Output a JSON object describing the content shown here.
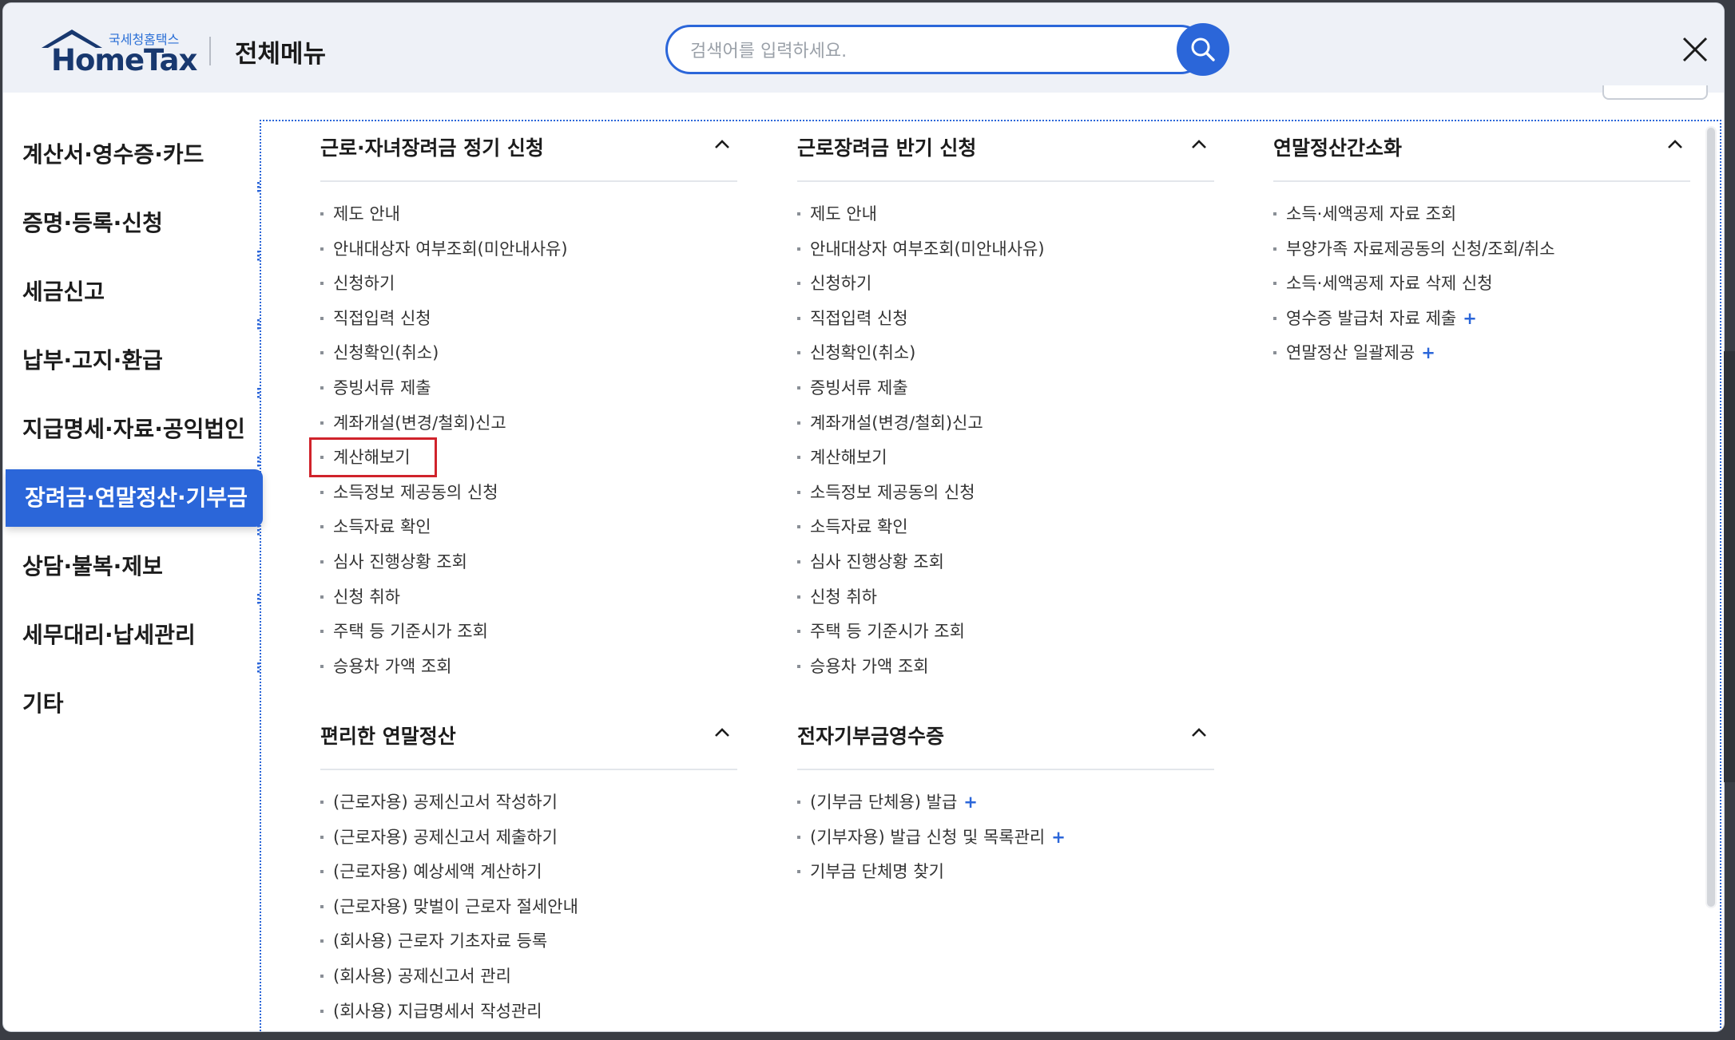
{
  "header": {
    "logo_sub": "국세청홈택스",
    "logo_main": "HomeTax",
    "title": "전체메뉴",
    "search_placeholder": "검색어를 입력하세요."
  },
  "sidebar": {
    "items": [
      {
        "label": "계산서·영수증·카드",
        "active": false
      },
      {
        "label": "증명·등록·신청",
        "active": false
      },
      {
        "label": "세금신고",
        "active": false
      },
      {
        "label": "납부·고지·환급",
        "active": false
      },
      {
        "label": "지급명세·자료·공익법인",
        "active": false
      },
      {
        "label": "장려금·연말정산·기부금",
        "active": true
      },
      {
        "label": "상담·불복·제보",
        "active": false
      },
      {
        "label": "세무대리·납세관리",
        "active": false
      },
      {
        "label": "기타",
        "active": false
      }
    ]
  },
  "sections": [
    {
      "title": "근로·자녀장려금 정기 신청",
      "items": [
        {
          "label": "제도 안내",
          "plus": false
        },
        {
          "label": "안내대상자 여부조회(미안내사유)",
          "plus": false
        },
        {
          "label": "신청하기",
          "plus": false
        },
        {
          "label": "직접입력 신청",
          "plus": false
        },
        {
          "label": "신청확인(취소)",
          "plus": false
        },
        {
          "label": "증빙서류 제출",
          "plus": false
        },
        {
          "label": "계좌개설(변경/철회)신고",
          "plus": false
        },
        {
          "label": "계산해보기",
          "plus": false
        },
        {
          "label": "소득정보 제공동의 신청",
          "plus": false
        },
        {
          "label": "소득자료 확인",
          "plus": false
        },
        {
          "label": "심사 진행상황 조회",
          "plus": false
        },
        {
          "label": "신청 취하",
          "plus": false
        },
        {
          "label": "주택 등 기준시가 조회",
          "plus": false
        },
        {
          "label": "승용차 가액 조회",
          "plus": false
        }
      ]
    },
    {
      "title": "근로장려금 반기 신청",
      "items": [
        {
          "label": "제도 안내",
          "plus": false
        },
        {
          "label": "안내대상자 여부조회(미안내사유)",
          "plus": false
        },
        {
          "label": "신청하기",
          "plus": false
        },
        {
          "label": "직접입력 신청",
          "plus": false
        },
        {
          "label": "신청확인(취소)",
          "plus": false
        },
        {
          "label": "증빙서류 제출",
          "plus": false
        },
        {
          "label": "계좌개설(변경/철회)신고",
          "plus": false
        },
        {
          "label": "계산해보기",
          "plus": false
        },
        {
          "label": "소득정보 제공동의 신청",
          "plus": false
        },
        {
          "label": "소득자료 확인",
          "plus": false
        },
        {
          "label": "심사 진행상황 조회",
          "plus": false
        },
        {
          "label": "신청 취하",
          "plus": false
        },
        {
          "label": "주택 등 기준시가 조회",
          "plus": false
        },
        {
          "label": "승용차 가액 조회",
          "plus": false
        }
      ]
    },
    {
      "title": "연말정산간소화",
      "items": [
        {
          "label": "소득·세액공제 자료 조회",
          "plus": false
        },
        {
          "label": "부양가족 자료제공동의 신청/조회/취소",
          "plus": false
        },
        {
          "label": "소득·세액공제 자료 삭제 신청",
          "plus": false
        },
        {
          "label": "영수증 발급처 자료 제출",
          "plus": true
        },
        {
          "label": "연말정산 일괄제공",
          "plus": true
        }
      ]
    },
    {
      "title": "편리한 연말정산",
      "items": [
        {
          "label": "(근로자용) 공제신고서 작성하기",
          "plus": false
        },
        {
          "label": "(근로자용) 공제신고서 제출하기",
          "plus": false
        },
        {
          "label": "(근로자용) 예상세액 계산하기",
          "plus": false
        },
        {
          "label": "(근로자용) 맞벌이 근로자 절세안내",
          "plus": false
        },
        {
          "label": "(회사용) 근로자 기초자료 등록",
          "plus": false
        },
        {
          "label": "(회사용) 공제신고서 관리",
          "plus": false
        },
        {
          "label": "(회사용) 지급명세서 작성관리",
          "plus": false
        }
      ]
    },
    {
      "title": "전자기부금영수증",
      "items": [
        {
          "label": "(기부금 단체용) 발급",
          "plus": true
        },
        {
          "label": "(기부자용) 발급 신청 및 목록관리",
          "plus": true
        },
        {
          "label": "기부금 단체명 찾기",
          "plus": false
        }
      ]
    }
  ],
  "plus_symbol": "+",
  "colors": {
    "accent": "#2b66d9",
    "highlight": "#d0232b",
    "header_bg": "#eef1f7"
  }
}
